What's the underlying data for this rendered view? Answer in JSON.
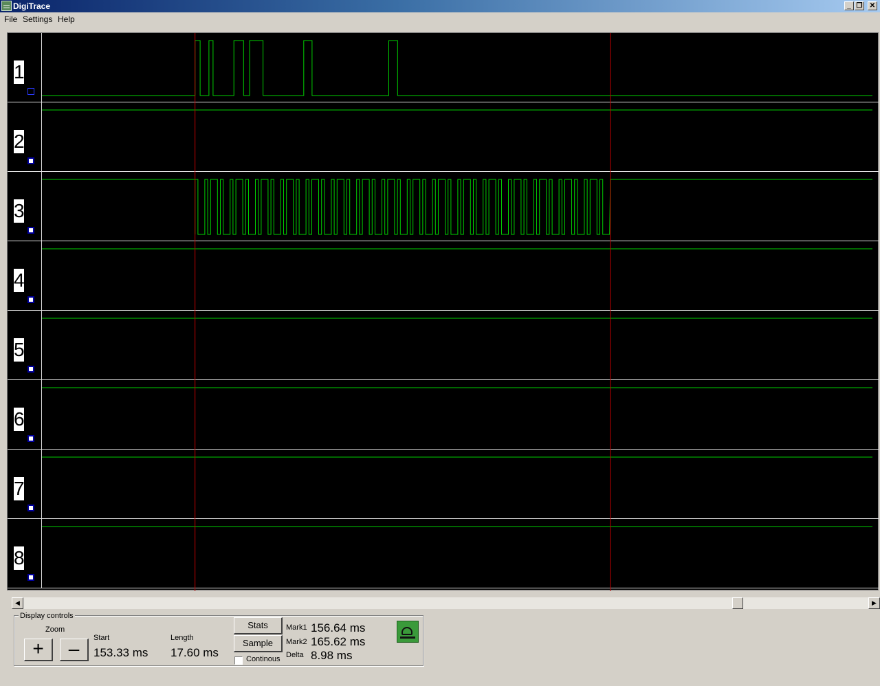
{
  "window": {
    "title": "DigiTrace"
  },
  "menu": {
    "file": "File",
    "settings": "Settings",
    "help": "Help"
  },
  "channels": [
    {
      "label": "1",
      "checked": false,
      "level": "low",
      "edges_ms": [
        156.64,
        156.75,
        156.94,
        157.03,
        157.48,
        157.69,
        157.82,
        158.11,
        158.99,
        159.17,
        160.83,
        161.02
      ]
    },
    {
      "label": "2",
      "checked": true,
      "level": "high",
      "edges_ms": []
    },
    {
      "label": "3",
      "checked": true,
      "level": "high",
      "edges_ms": [],
      "burst": {
        "start_ms": 156.64,
        "end_ms": 165.62
      }
    },
    {
      "label": "4",
      "checked": true,
      "level": "high",
      "edges_ms": []
    },
    {
      "label": "5",
      "checked": true,
      "level": "high",
      "edges_ms": []
    },
    {
      "label": "6",
      "checked": true,
      "level": "high",
      "edges_ms": []
    },
    {
      "label": "7",
      "checked": true,
      "level": "high",
      "edges_ms": []
    },
    {
      "label": "8",
      "checked": true,
      "level": "high",
      "edges_ms": []
    }
  ],
  "markers": {
    "mark1_ms": 156.64,
    "mark2_ms": 165.62
  },
  "view": {
    "start_ms": 153.33,
    "length_ms": 17.6
  },
  "scroll_position": 0.85,
  "colors": {
    "trace": "#00d000",
    "marker": "#c00000",
    "background": "#000000"
  },
  "controls": {
    "group_title": "Display controls",
    "zoom_label": "Zoom",
    "zoom_in": "+",
    "zoom_out": "–",
    "start_label": "Start",
    "start_value": "153.33 ms",
    "length_label": "Length",
    "length_value": "17.60 ms",
    "stats_button": "Stats",
    "sample_button": "Sample",
    "continuous_label": "Continous",
    "mark1_label": "Mark1",
    "mark1_value": "156.64 ms",
    "mark2_label": "Mark2",
    "mark2_value": "165.62 ms",
    "delta_label": "Delta",
    "delta_value": "8.98 ms"
  },
  "icons": {
    "status": "pen-icon"
  }
}
